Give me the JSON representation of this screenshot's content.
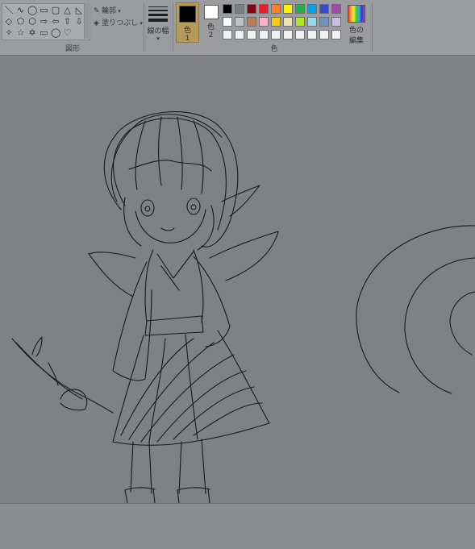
{
  "ribbon": {
    "shapes": {
      "group_label": "図形",
      "outline_label": "輪郭",
      "fill_label": "塗りつぶし",
      "glyphs": [
        "＼",
        "∿",
        "◯",
        "▭",
        "▢",
        "△",
        "◺",
        "◇",
        "⬠",
        "⬡",
        "⇨",
        "⇦",
        "⇧",
        "⇩",
        "✧",
        "☆",
        "✡",
        "▭",
        "◯",
        "♡"
      ]
    },
    "line_width_label": "線の幅",
    "colors": {
      "group_label": "色",
      "color1_label": "色",
      "color1_num": "1",
      "color2_label": "色",
      "color2_num": "2",
      "color1_value": "#000000",
      "color2_value": "#ffffff",
      "edit_label_1": "色の",
      "edit_label_2": "編集",
      "palette_row1": [
        "#000000",
        "#7f7f7f",
        "#880015",
        "#ed1c24",
        "#ff7f27",
        "#fff200",
        "#22b14c",
        "#00a2e8",
        "#3f48cc",
        "#a349a4"
      ],
      "palette_row2": [
        "#ffffff",
        "#c3c3c3",
        "#b97a57",
        "#ffaec9",
        "#ffc90e",
        "#efe4b0",
        "#b5e61d",
        "#99d9ea",
        "#7092be",
        "#c8bfe7"
      ],
      "palette_row3": [
        "#f2f2f2",
        "#f2f2f2",
        "#f2f2f2",
        "#f2f2f2",
        "#f2f2f2",
        "#f2f2f2",
        "#f2f2f2",
        "#f2f2f2",
        "#f2f2f2",
        "#f2f2f2"
      ]
    }
  },
  "canvas": {
    "description_shapes": "sketch"
  }
}
